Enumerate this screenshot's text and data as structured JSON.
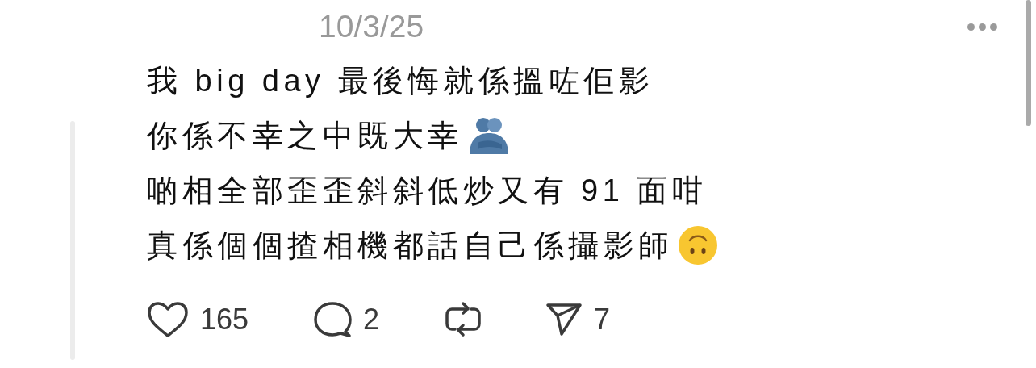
{
  "date": "10/3/25",
  "lines": [
    {
      "kind": "plain",
      "text": "我 big day 最後悔就係搵咗佢影"
    },
    {
      "kind": "hug",
      "text": "你係不幸之中既大幸"
    },
    {
      "kind": "plain",
      "text": "啲相全部歪歪斜斜低炒又有 91 面咁"
    },
    {
      "kind": "upside_down",
      "text": "真係個個揸相機都話自己係攝影師"
    }
  ],
  "actions": [
    {
      "kind": "like",
      "count": "165"
    },
    {
      "kind": "reply",
      "count": "2"
    },
    {
      "kind": "repost"
    },
    {
      "kind": "share",
      "count": "7"
    }
  ]
}
